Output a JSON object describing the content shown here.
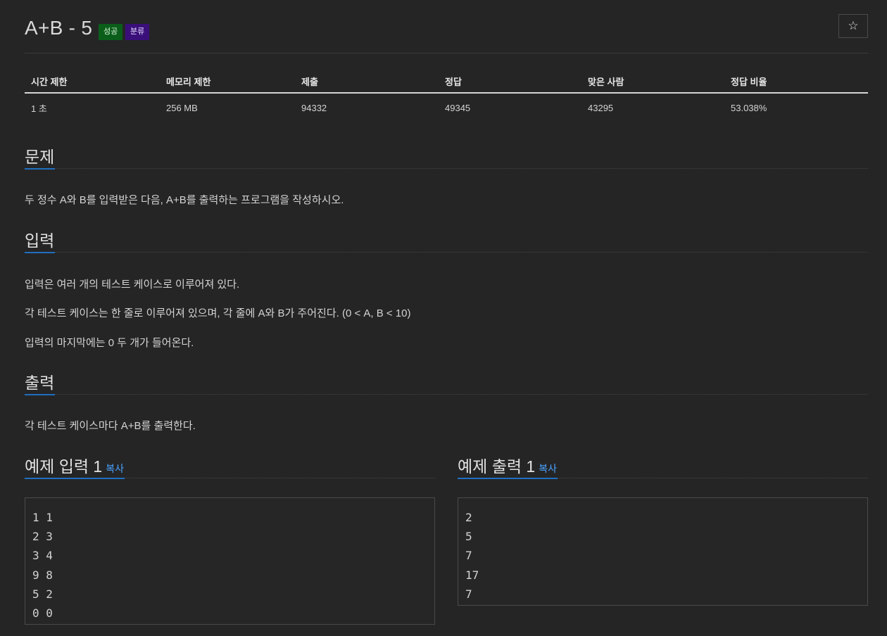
{
  "header": {
    "title": "A+B - 5",
    "badges": {
      "success": "성공",
      "category": "분류"
    },
    "star_icon": "☆"
  },
  "stats": {
    "headers": [
      "시간 제한",
      "메모리 제한",
      "제출",
      "정답",
      "맞은 사람",
      "정답 비율"
    ],
    "values": [
      "1 초",
      "256 MB",
      "94332",
      "49345",
      "43295",
      "53.038%"
    ]
  },
  "problem": {
    "heading": "문제",
    "text": "두 정수 A와 B를 입력받은 다음, A+B를 출력하는 프로그램을 작성하시오."
  },
  "input": {
    "heading": "입력",
    "lines": [
      "입력은 여러 개의 테스트 케이스로 이루어져 있다.",
      "각 테스트 케이스는 한 줄로 이루어져 있으며, 각 줄에 A와 B가 주어진다. (0 < A, B < 10)",
      "입력의 마지막에는 0 두 개가 들어온다."
    ]
  },
  "output": {
    "heading": "출력",
    "text": "각 테스트 케이스마다 A+B를 출력한다."
  },
  "sample_input": {
    "heading": "예제 입력 1",
    "copy_label": "복사",
    "lines": [
      "1 1",
      "2 3",
      "3 4",
      "9 8",
      "5 2",
      "0 0"
    ]
  },
  "sample_output": {
    "heading": "예제 출력 1",
    "copy_label": "복사",
    "lines": [
      "2",
      "5",
      "7",
      "17",
      "7"
    ]
  },
  "colors": {
    "background": "#252526",
    "accent_underline": "#1f6fbf",
    "link": "#4aa3ff",
    "badge_success": "#0b5e1a",
    "badge_category": "#3a0f7a"
  }
}
